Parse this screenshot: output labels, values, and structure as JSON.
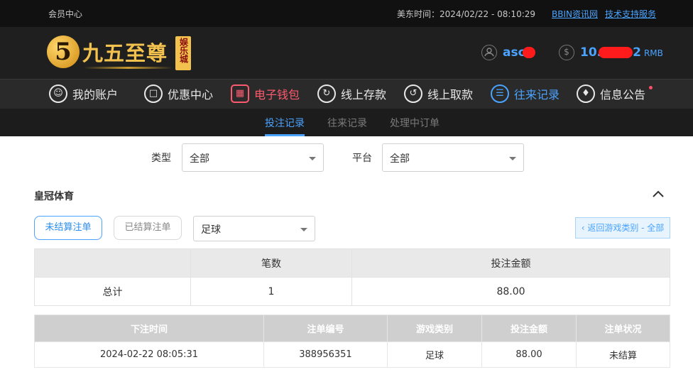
{
  "topbar": {
    "member_center": "会员中心",
    "time_label": "美东时间：2024/02/22 - 08:10:29",
    "link_bbin": "BBIN资讯网",
    "link_support": "技术支持服务"
  },
  "header": {
    "logo_numeral": "5",
    "logo_name": "九五至尊",
    "logo_badge": "娱乐城",
    "username": "asc",
    "balance_visible": "10.",
    "balance_tail": "2",
    "currency": "RMB"
  },
  "nav": {
    "items": [
      {
        "label": "我的账户",
        "icon": "user-icon"
      },
      {
        "label": "优惠中心",
        "icon": "gift-icon"
      },
      {
        "label": "电子钱包",
        "icon": "wallet-icon"
      },
      {
        "label": "线上存款",
        "icon": "deposit-icon"
      },
      {
        "label": "线上取款",
        "icon": "withdraw-icon"
      },
      {
        "label": "往来记录",
        "icon": "records-icon"
      },
      {
        "label": "信息公告",
        "icon": "bell-icon"
      }
    ]
  },
  "subtabs": [
    "投注记录",
    "往来记录",
    "处理中订单"
  ],
  "filters": {
    "type_label": "类型",
    "type_value": "全部",
    "platform_label": "平台",
    "platform_value": "全部"
  },
  "section": {
    "title": "皇冠体育",
    "btn_unsettled": "未结算注单",
    "btn_settled": "已结算注单",
    "sport_value": "足球",
    "back_button": "‹ 返回游戏类别 - 全部"
  },
  "summary": {
    "headers": [
      "",
      "笔数",
      "投注金额"
    ],
    "row": [
      "总计",
      "1",
      "88.00"
    ]
  },
  "detail": {
    "headers": [
      "下注时间",
      "注单编号",
      "游戏类别",
      "投注金额",
      "注单状况"
    ],
    "rows": [
      [
        "2024-02-22 08:05:31",
        "388956351",
        "足球",
        "88.00",
        "未结算"
      ]
    ]
  },
  "colors": {
    "accent": "#4aa3ff",
    "nav_active": "#ff5a6e",
    "gold": "#f2c14e"
  }
}
